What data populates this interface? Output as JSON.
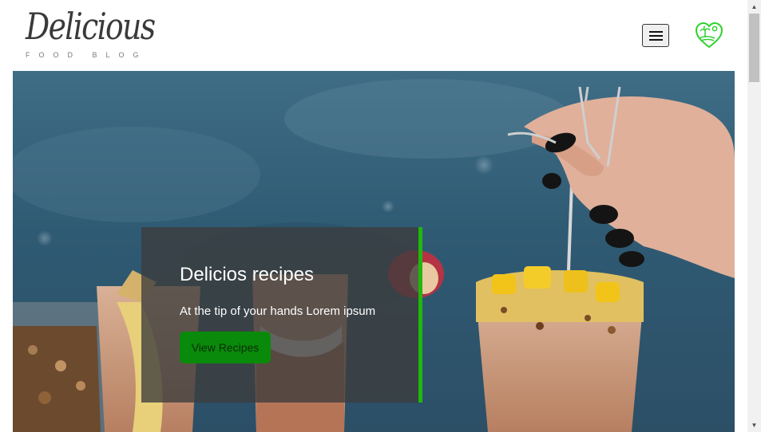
{
  "header": {
    "logo_title": "Delicious",
    "logo_subtitle": "FOOD BLOG",
    "menu_button_icon": "hamburger-menu-icon",
    "heart_icon": "heart-island-icon",
    "accent_color": "#1fb80d"
  },
  "hero": {
    "title": "Delicios recipes",
    "text": "At the tip of your hands Lorem ipsum",
    "button_label": "View Recipes",
    "button_color": "#0a8a0a"
  },
  "scrollbar": {
    "up_icon": "▲",
    "down_icon": "▼"
  }
}
